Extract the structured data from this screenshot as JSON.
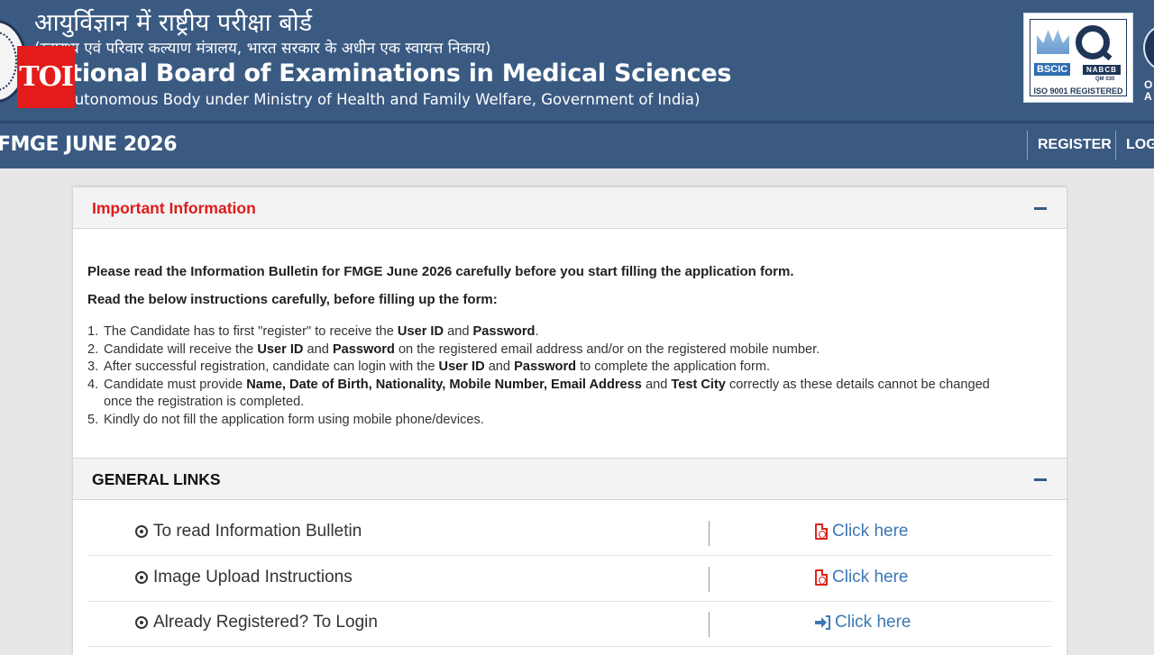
{
  "header": {
    "hindi_title": "आयुर्विज्ञान में राष्ट्रीय परीक्षा बोर्ड",
    "hindi_subtitle": "(स्वास्थ्य एवं परिवार कल्याण मंत्रालय, भारत सरकार के अधीन एक स्वायत्त निकाय)",
    "english_title": "National Board of Examinations in Medical Sciences",
    "english_subtitle": "(An Autonomous Body under Ministry of Health and Family Welfare, Government of India)",
    "toi_label": "TOI",
    "iso": {
      "bscic": "BSCIC",
      "nabcb": "NABCB",
      "qm": "QM 030",
      "registered": "ISO 9001 REGISTERED"
    },
    "right_letters": "O A"
  },
  "nav": {
    "brand": "FMGE JUNE 2026",
    "register": "REGISTER",
    "login": "LOGIN"
  },
  "important": {
    "title": "Important Information",
    "para1": "Please read the Information Bulletin for FMGE June 2026 carefully before you start filling the application form.",
    "para2": "Read the below instructions carefully, before filling up the form:",
    "items": [
      {
        "num": "1.",
        "t1": "The Candidate has to first \"register\" to receive the ",
        "b1": "User ID",
        "t2": " and ",
        "b2": "Password",
        "t3": "."
      },
      {
        "num": "2.",
        "t1": "Candidate will receive the ",
        "b1": "User ID",
        "t2": " and ",
        "b2": "Password",
        "t3": " on the registered email address and/or on the registered mobile number."
      },
      {
        "num": "3.",
        "t1": "After successful registration, candidate can login with the ",
        "b1": "User ID",
        "t2": " and ",
        "b2": "Password",
        "t3": " to complete the application form."
      },
      {
        "num": "4.",
        "t1": "Candidate must provide ",
        "b1": "Name, Date of Birth, Nationality, Mobile Number, Email Address",
        "t2": " and ",
        "b2": "Test City",
        "t3": " correctly as these details cannot be changed once the registration is completed."
      },
      {
        "num": "5.",
        "t1": "Kindly do not fill the application form using mobile phone/devices.",
        "b1": "",
        "t2": "",
        "b2": "",
        "t3": ""
      }
    ]
  },
  "general_links": {
    "title": "GENERAL LINKS",
    "rows": [
      {
        "label": "To read Information Bulletin",
        "action": "Click here",
        "icon": "pdf-icon"
      },
      {
        "label": "Image Upload Instructions",
        "action": "Click here",
        "icon": "pdf-icon"
      },
      {
        "label": "Already Registered? To Login",
        "action": "Click here",
        "icon": "sign-in-icon"
      }
    ]
  },
  "colors": {
    "header_bg": "#3a5a82",
    "important_title": "#e01b1b",
    "link": "#3d78b4",
    "toi_red": "#e31b1b"
  }
}
